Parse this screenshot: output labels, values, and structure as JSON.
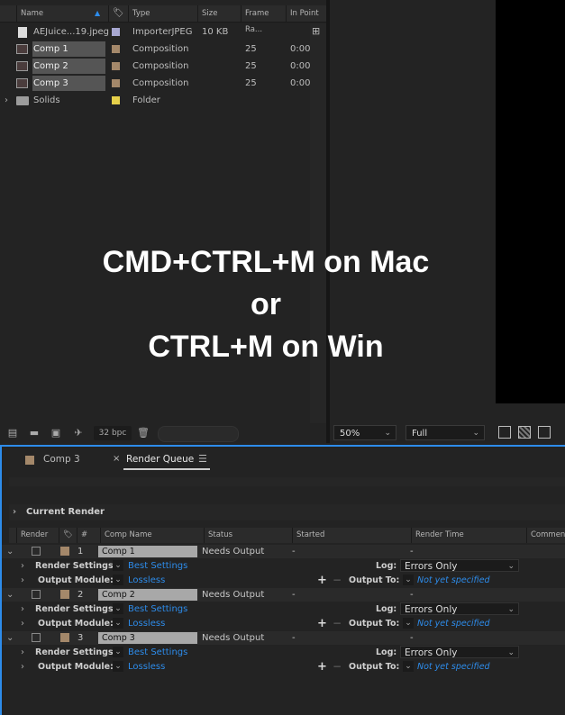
{
  "project": {
    "columns": [
      "Name",
      "Type",
      "Size",
      "Frame Ra...",
      "In Point"
    ],
    "items": [
      {
        "name": "AEJuice...19.jpeg",
        "type": "ImporterJPEG",
        "size": "10 KB",
        "frame_rate": "",
        "in_point": "",
        "swatch": "#a6a6d0",
        "icon": "file-icon",
        "selected": false
      },
      {
        "name": "Comp 1",
        "type": "Composition",
        "size": "",
        "frame_rate": "25",
        "in_point": "0:00",
        "swatch": "#a4886a",
        "icon": "composition-icon",
        "selected": true
      },
      {
        "name": "Comp 2",
        "type": "Composition",
        "size": "",
        "frame_rate": "25",
        "in_point": "0:00",
        "swatch": "#a4886a",
        "icon": "composition-icon",
        "selected": true
      },
      {
        "name": "Comp 3",
        "type": "Composition",
        "size": "",
        "frame_rate": "25",
        "in_point": "0:00",
        "swatch": "#a4886a",
        "icon": "composition-icon",
        "selected": true
      },
      {
        "name": "Solids",
        "type": "Folder",
        "size": "",
        "frame_rate": "",
        "in_point": "",
        "swatch": "#e6d04a",
        "icon": "folder-icon",
        "selected": false
      }
    ],
    "bpc": "32 bpc"
  },
  "viewer": {
    "zoom": "50%",
    "resolution": "Full"
  },
  "overlay": {
    "line1": "CMD+CTRL+M on Mac",
    "line2": "or",
    "line3": "CTRL+M on Win"
  },
  "render_queue": {
    "tabs": [
      "Comp 3",
      "Render Queue"
    ],
    "current_render": "Current Render",
    "columns": [
      "Render",
      "#",
      "Comp Name",
      "Status",
      "Started",
      "Render Time",
      "Comment"
    ],
    "labels": {
      "render_settings": "Render Settings:",
      "output_module": "Output Module:",
      "log": "Log:",
      "output_to": "Output To:"
    },
    "items": [
      {
        "num": "1",
        "comp": "Comp 1",
        "status": "Needs Output",
        "started": "-",
        "render_time": "-",
        "render_settings": "Best Settings",
        "output_module": "Lossless",
        "log": "Errors Only",
        "output_to": "Not yet specified"
      },
      {
        "num": "2",
        "comp": "Comp 2",
        "status": "Needs Output",
        "started": "-",
        "render_time": "-",
        "render_settings": "Best Settings",
        "output_module": "Lossless",
        "log": "Errors Only",
        "output_to": "Not yet specified"
      },
      {
        "num": "3",
        "comp": "Comp 3",
        "status": "Needs Output",
        "started": "-",
        "render_time": "-",
        "render_settings": "Best Settings",
        "output_module": "Lossless",
        "log": "Errors Only",
        "output_to": "Not yet specified"
      }
    ]
  }
}
